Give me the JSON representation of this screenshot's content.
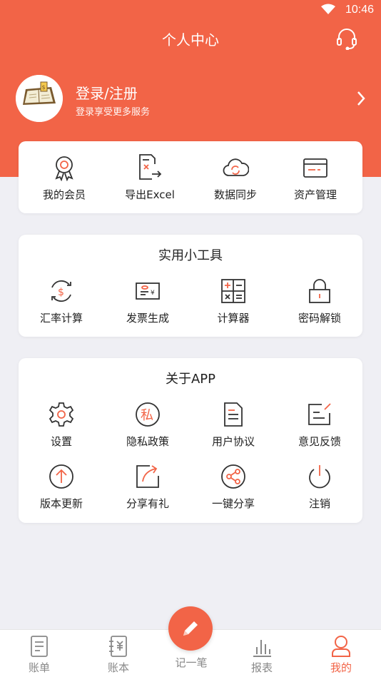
{
  "status_bar": {
    "time": "10:46",
    "icons": [
      "wifi-icon"
    ]
  },
  "header": {
    "title": "个人中心",
    "service_icon": "headset-icon"
  },
  "profile": {
    "title": "登录/注册",
    "subtitle": "登录享受更多服务",
    "avatar_icon": "notebook-avatar"
  },
  "card1": {
    "items": [
      {
        "label": "我的会员",
        "icon": "badge-icon"
      },
      {
        "label": "导出Excel",
        "icon": "excel-export-icon"
      },
      {
        "label": "数据同步",
        "icon": "cloud-sync-icon"
      },
      {
        "label": "资产管理",
        "icon": "card-icon"
      }
    ]
  },
  "tools": {
    "title": "实用小工具",
    "items": [
      {
        "label": "汇率计算",
        "icon": "currency-exchange-icon"
      },
      {
        "label": "发票生成",
        "icon": "invoice-icon"
      },
      {
        "label": "计算器",
        "icon": "calculator-icon"
      },
      {
        "label": "密码解锁",
        "icon": "lock-icon"
      }
    ]
  },
  "about": {
    "title": "关于APP",
    "items": [
      {
        "label": "设置",
        "icon": "gear-icon"
      },
      {
        "label": "隐私政策",
        "icon": "privacy-icon"
      },
      {
        "label": "用户协议",
        "icon": "document-icon"
      },
      {
        "label": "意见反馈",
        "icon": "feedback-icon"
      },
      {
        "label": "版本更新",
        "icon": "update-icon"
      },
      {
        "label": "分享有礼",
        "icon": "share-gift-icon"
      },
      {
        "label": "一键分享",
        "icon": "share-icon"
      },
      {
        "label": "注销",
        "icon": "power-icon"
      }
    ]
  },
  "tabbar": {
    "tabs": [
      {
        "label": "账单",
        "icon": "bill-icon",
        "active": false
      },
      {
        "label": "账本",
        "icon": "ledger-icon",
        "active": false
      },
      {
        "label": "记一笔",
        "icon": "pencil-icon",
        "active": false
      },
      {
        "label": "报表",
        "icon": "chart-icon",
        "active": false
      },
      {
        "label": "我的",
        "icon": "user-icon",
        "active": true
      }
    ]
  },
  "colors": {
    "accent": "#f26447",
    "background": "#efeff4",
    "icon_dark": "#333333"
  },
  "privacy_glyph": "私"
}
